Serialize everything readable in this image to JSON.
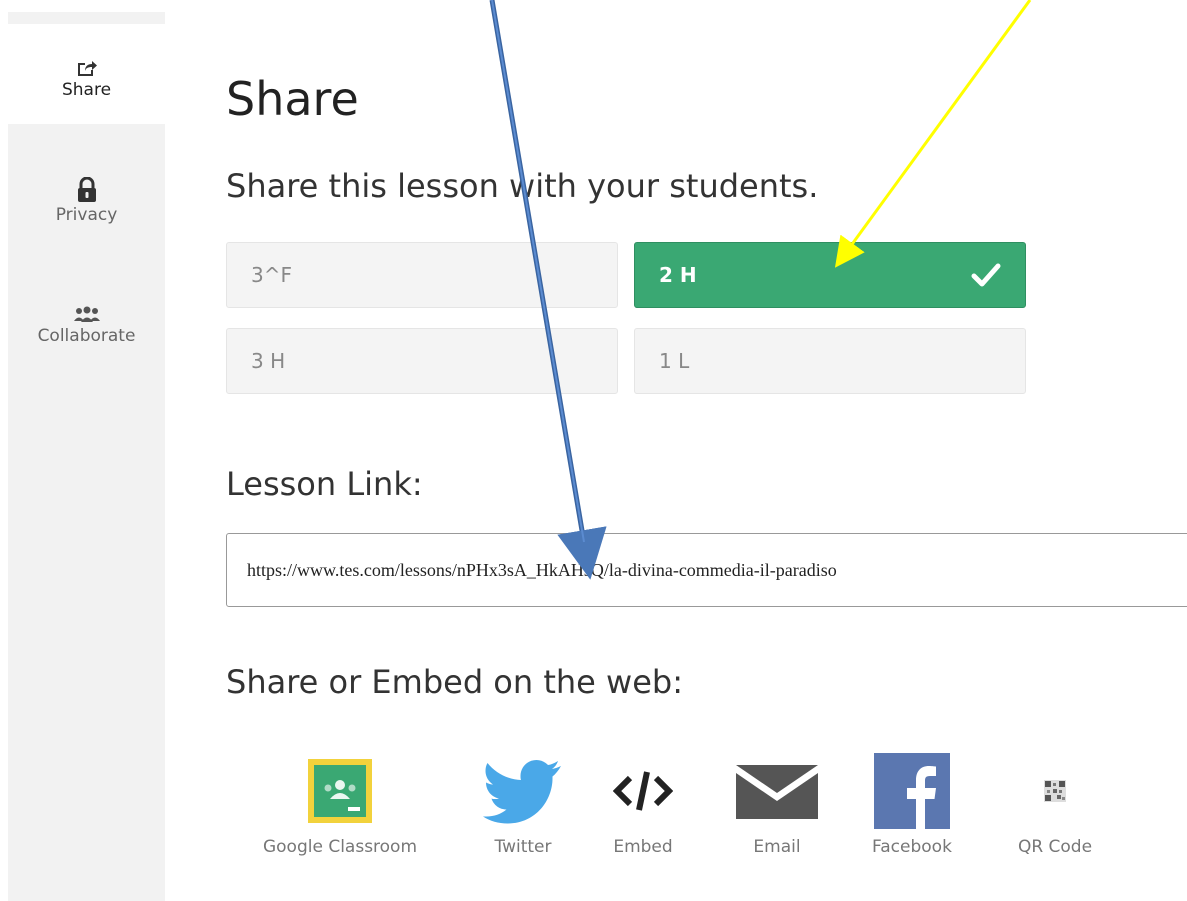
{
  "sidebar": {
    "items": [
      {
        "label": "Share",
        "icon": "share-icon"
      },
      {
        "label": "Privacy",
        "icon": "lock-icon"
      },
      {
        "label": "Collaborate",
        "icon": "users-icon"
      }
    ]
  },
  "main": {
    "title": "Share",
    "subtitle": "Share this lesson with your students.",
    "classes": [
      {
        "label": "3^F",
        "selected": false
      },
      {
        "label": "2 H",
        "selected": true
      },
      {
        "label": "3 H",
        "selected": false
      },
      {
        "label": "1 L",
        "selected": false
      }
    ],
    "lesson_link_heading": "Lesson Link:",
    "lesson_link_url": "https://www.tes.com/lessons/nPHx3sA_HkAHsQ/la-divina-commedia-il-paradiso",
    "embed_heading": "Share or Embed on the web:",
    "share_options": [
      {
        "label": "Google Classroom",
        "icon": "google-classroom-icon"
      },
      {
        "label": "Twitter",
        "icon": "twitter-icon"
      },
      {
        "label": "Embed",
        "icon": "code-icon"
      },
      {
        "label": "Email",
        "icon": "envelope-icon"
      },
      {
        "label": "Facebook",
        "icon": "facebook-icon"
      },
      {
        "label": "QR Code",
        "icon": "qr-code-icon"
      }
    ]
  },
  "colors": {
    "selected_green": "#3aa873",
    "annotation_blue": "#4a78b8",
    "annotation_yellow": "#ffff00",
    "twitter_blue": "#4aa8e8",
    "facebook_blue": "#5b77b0",
    "classroom_yellow": "#f2d23c",
    "classroom_green": "#3aa873"
  }
}
